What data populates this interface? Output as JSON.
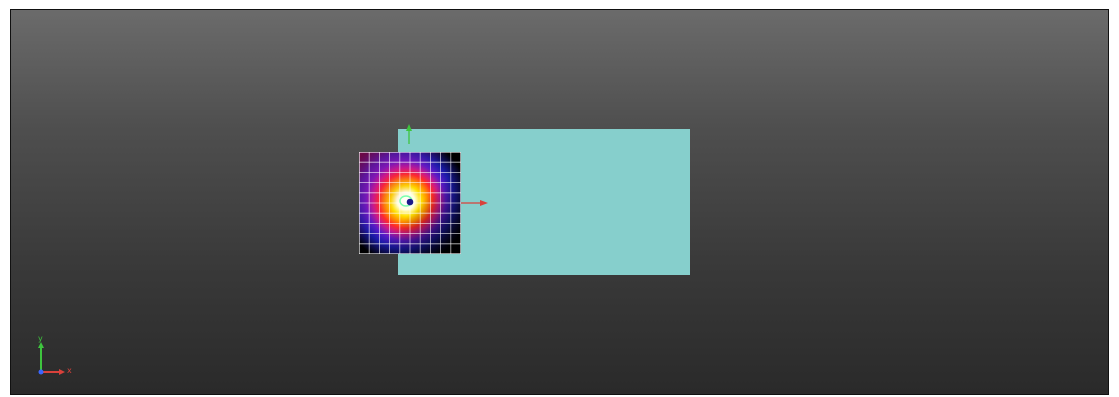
{
  "viewport": {
    "background_top": "#6b6b6b",
    "background_bottom": "#2a2a2a"
  },
  "scene": {
    "plate_color": "#86cfcc",
    "heatmap": {
      "grid_rows": 10,
      "grid_cols": 10,
      "colormap": [
        "#000000",
        "#1a1aa8",
        "#5a1ac8",
        "#c81a8c",
        "#ff2a2a",
        "#ff8a00",
        "#ffe000",
        "#ffffff"
      ],
      "hotspot_color": "#ffffff",
      "marker_inner_color": "#1b1b8a",
      "marker_ring_color": "#7cffb0"
    },
    "gizmo": {
      "x_axis_color": "#d9413b",
      "y_axis_color": "#3ec43e"
    }
  },
  "axis_triad": {
    "x_label": "x",
    "y_label": "y",
    "x_color": "#d9413b",
    "y_color": "#3ec43e",
    "z_color": "#3a66ff"
  }
}
